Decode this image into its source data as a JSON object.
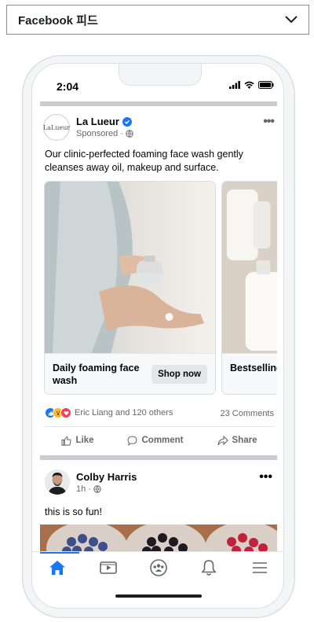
{
  "placement": {
    "label": "Facebook 피드"
  },
  "status_bar": {
    "time": "2:04"
  },
  "post1": {
    "page_name": "La Lueur",
    "subtitle": "Sponsored",
    "avatar_text": "LaLueur",
    "body": "Our clinic-perfected foaming face wash gently cleanses away oil, makeup and surface.",
    "cards": [
      {
        "title": "Daily foaming face wash",
        "button": "Shop now"
      },
      {
        "title": "Bestselling everyday m",
        "button": ""
      }
    ],
    "reactions_text": "Eric Liang and 120 others",
    "comments_text": "23 Comments",
    "actions": {
      "like": "Like",
      "comment": "Comment",
      "share": "Share"
    }
  },
  "post2": {
    "name": "Colby Harris",
    "time": "1h",
    "body": "this is so fun!"
  },
  "bottom_nav": {
    "items": [
      "home-icon",
      "video-icon",
      "groups-icon",
      "notifications-icon",
      "menu-icon"
    ],
    "active": "home-icon"
  },
  "colors": {
    "accent": "#1877f2",
    "divider": "#c9ccd1",
    "muted_text": "#65676b"
  }
}
